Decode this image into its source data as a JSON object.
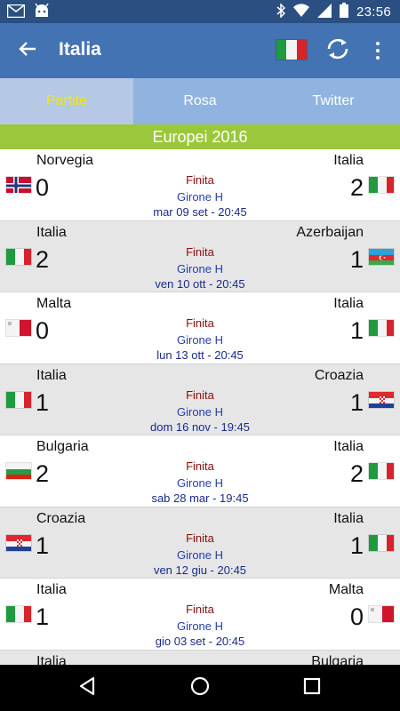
{
  "status_bar": {
    "time": "23:56",
    "icons": [
      "gmail-icon",
      "android-icon",
      "bluetooth-icon",
      "wifi-icon",
      "signal-icon",
      "battery-icon"
    ]
  },
  "app_bar": {
    "title": "Italia",
    "icons": [
      "back-arrow-icon",
      "italy-flag-icon",
      "refresh-icon",
      "more-vert-icon"
    ]
  },
  "tabs": [
    {
      "label": "Partite",
      "active": true
    },
    {
      "label": "Rosa",
      "active": false
    },
    {
      "label": "Twitter",
      "active": false
    }
  ],
  "competition": "Europei 2016",
  "matches": [
    {
      "home": "Norvegia",
      "home_score": "0",
      "away": "Italia",
      "away_score": "2",
      "status": "Finita",
      "group": "Girone H",
      "date": "mar 09 set - 20:45",
      "home_flag": "norway",
      "away_flag": "italy"
    },
    {
      "home": "Italia",
      "home_score": "2",
      "away": "Azerbaijan",
      "away_score": "1",
      "status": "Finita",
      "group": "Girone H",
      "date": "ven 10 ott - 20:45",
      "home_flag": "italy",
      "away_flag": "azerbaijan"
    },
    {
      "home": "Malta",
      "home_score": "0",
      "away": "Italia",
      "away_score": "1",
      "status": "Finita",
      "group": "Girone H",
      "date": "lun 13 ott - 20:45",
      "home_flag": "malta",
      "away_flag": "italy"
    },
    {
      "home": "Italia",
      "home_score": "1",
      "away": "Croazia",
      "away_score": "1",
      "status": "Finita",
      "group": "Girone H",
      "date": "dom 16 nov - 19:45",
      "home_flag": "italy",
      "away_flag": "croatia"
    },
    {
      "home": "Bulgaria",
      "home_score": "2",
      "away": "Italia",
      "away_score": "2",
      "status": "Finita",
      "group": "Girone H",
      "date": "sab 28 mar - 19:45",
      "home_flag": "bulgaria",
      "away_flag": "italy"
    },
    {
      "home": "Croazia",
      "home_score": "1",
      "away": "Italia",
      "away_score": "1",
      "status": "Finita",
      "group": "Girone H",
      "date": "ven 12 giu - 20:45",
      "home_flag": "croatia",
      "away_flag": "italy"
    },
    {
      "home": "Italia",
      "home_score": "1",
      "away": "Malta",
      "away_score": "0",
      "status": "Finita",
      "group": "Girone H",
      "date": "gio 03 set - 20:45",
      "home_flag": "italy",
      "away_flag": "malta"
    },
    {
      "home": "Italia",
      "home_score": "",
      "away": "Bulgaria",
      "away_score": "",
      "status": "",
      "group": "",
      "date": "",
      "home_flag": "italy",
      "away_flag": "bulgaria"
    }
  ],
  "nav_bar": {
    "icons": [
      "back-triangle-icon",
      "home-circle-icon",
      "recents-square-icon"
    ]
  },
  "colors": {
    "status_bar": "#2a4f80",
    "app_bar": "#4473b3",
    "tabs_bg": "#90b3e0",
    "active_tab_bg": "#b5c9e5",
    "active_tab_text": "#f5e900",
    "competition_header": "#9bc83a",
    "status_text": "#8b0c0c",
    "group_text": "#2540a8"
  }
}
